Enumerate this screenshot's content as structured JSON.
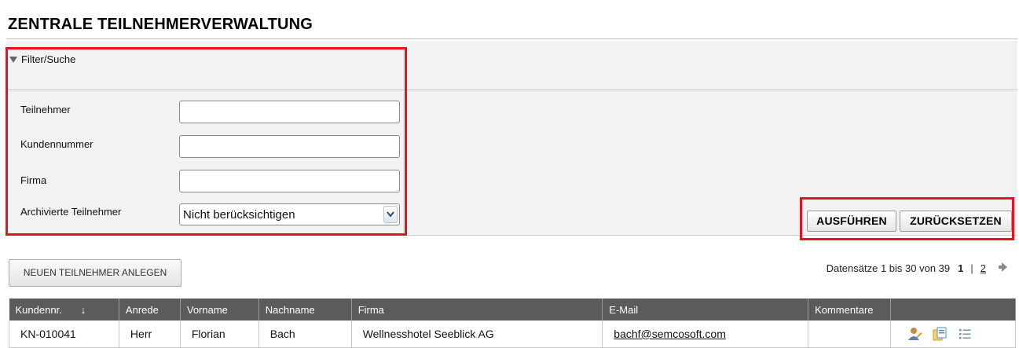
{
  "page": {
    "title": "ZENTRALE TEILNEHMERVERWALTUNG"
  },
  "filter": {
    "toggle_label": "Filter/Suche",
    "fields": [
      {
        "label": "Teilnehmer",
        "value": ""
      },
      {
        "label": "Kundennummer",
        "value": ""
      },
      {
        "label": "Firma",
        "value": ""
      }
    ],
    "archived": {
      "label": "Archivierte Teilnehmer",
      "selected": "Nicht berücksichtigen"
    },
    "execute_label": "AUSFÜHREN",
    "reset_label": "ZURÜCKSETZEN"
  },
  "actions": {
    "new_participant_label": "NEUEN TEILNEHMER ANLEGEN"
  },
  "pager": {
    "records": "Datensätze 1 bis 30 von 39",
    "current_page": "1",
    "separator": "|",
    "next_page": "2"
  },
  "table": {
    "columns": [
      "Kundennr.",
      "Anrede",
      "Vorname",
      "Nachname",
      "Firma",
      "E-Mail",
      "Kommentare",
      ""
    ],
    "sort_indicator": "↓",
    "rows": [
      {
        "kundennr": "KN-010041",
        "anrede": "Herr",
        "vorname": "Florian",
        "nachname": "Bach",
        "firma": "Wellnesshotel Seeblick AG",
        "email": "bachf@semcosoft.com",
        "kommentare": "",
        "icons": [
          "edit-user-icon",
          "copy-document-icon",
          "list-icon"
        ]
      }
    ]
  },
  "colors": {
    "highlight": "#e8111b",
    "header_bg": "#5b5b5b",
    "panel_bg": "#f2f2f2"
  }
}
